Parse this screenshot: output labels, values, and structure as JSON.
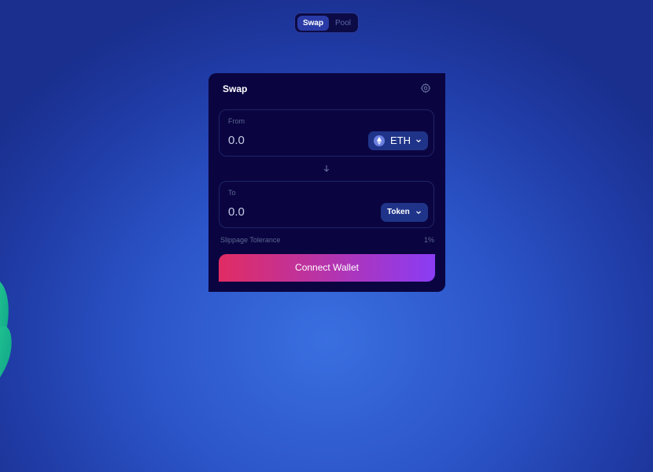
{
  "nav": {
    "tabs": [
      {
        "label": "Swap",
        "active": true
      },
      {
        "label": "Pool",
        "active": false
      }
    ]
  },
  "swap_card": {
    "title": "Swap",
    "settings_icon": "gear-icon",
    "from": {
      "label": "From",
      "amount": "0.0",
      "token": "ETH",
      "token_icon": "ethereum-icon"
    },
    "direction_icon": "arrow-down-icon",
    "to": {
      "label": "To",
      "amount": "0.0",
      "token": "Token"
    },
    "slippage": {
      "label": "Slippage Tolerance",
      "value": "1%"
    },
    "connect_label": "Connect Wallet"
  },
  "colors": {
    "background": "#2b54c8",
    "card": "#0a0541",
    "token_button": "#1f3489",
    "gradient_start": "#e12c63",
    "gradient_end": "#8a3cf5",
    "decor": "#1fbf8f"
  }
}
